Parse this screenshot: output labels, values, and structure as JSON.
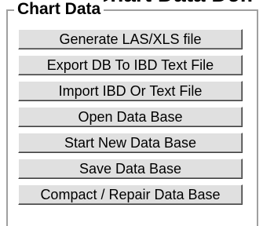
{
  "header": {
    "clipped_title": "Chart Data Defi"
  },
  "group": {
    "legend": "Chart Data",
    "buttons": [
      {
        "label": "Generate LAS/XLS file"
      },
      {
        "label": "Export DB To IBD Text File"
      },
      {
        "label": "Import IBD Or Text File"
      },
      {
        "label": "Open Data Base"
      },
      {
        "label": "Start New Data Base"
      },
      {
        "label": "Save Data Base"
      },
      {
        "label": "Compact / Repair Data Base"
      }
    ]
  },
  "colors": {
    "button_face": "#e0e0e0",
    "frame": "#a0a0a0",
    "background": "#ffffff"
  }
}
